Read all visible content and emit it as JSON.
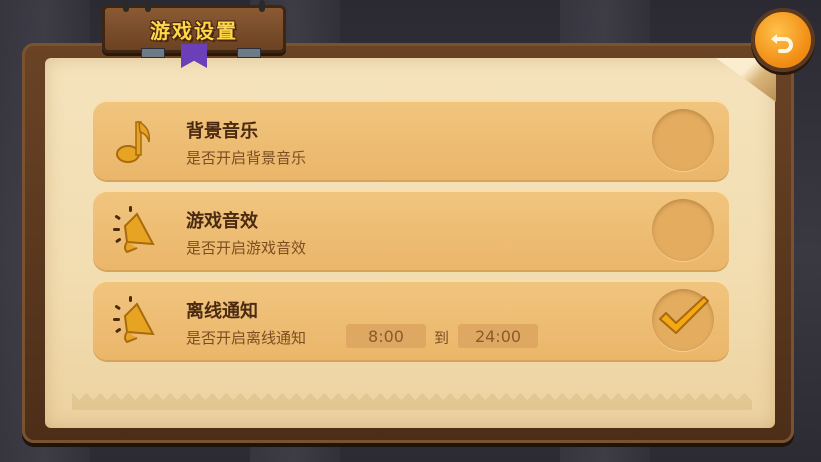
{
  "title": "游戏设置",
  "back_icon": "undo-arrow-icon",
  "colors": {
    "accent": "#ffd84a",
    "row_bg": "#eab66a",
    "title_text": "#4a2a10",
    "sub_text": "#7b4e22",
    "check": "#f5a814"
  },
  "settings": [
    {
      "title": "背景音乐",
      "subtitle": "是否开启背景音乐",
      "icon": "music-note-icon",
      "enabled": false
    },
    {
      "title": "游戏音效",
      "subtitle": "是否开启游戏音效",
      "icon": "speaker-icon",
      "enabled": false
    },
    {
      "title": "离线通知",
      "subtitle": "是否开启离线通知",
      "icon": "speaker-icon",
      "enabled": true,
      "time_start": "8:00",
      "time_to_label": "到",
      "time_end": "24:00"
    }
  ]
}
